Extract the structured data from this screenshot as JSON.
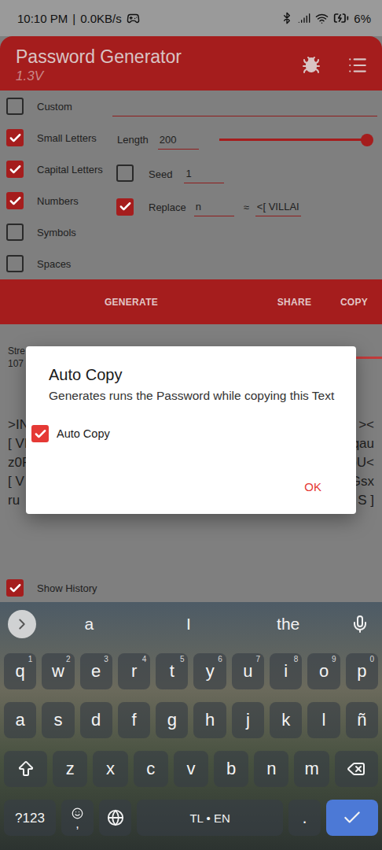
{
  "status_bar": {
    "time": "10:10 PM",
    "separator": "|",
    "network_speed": "0.0KB/s",
    "battery": "6%",
    "charging": true
  },
  "app_bar": {
    "title": "Password Generator",
    "version": "1.3V"
  },
  "options": [
    {
      "label": "Custom",
      "checked": false
    },
    {
      "label": "Small Letters",
      "checked": true
    },
    {
      "label": "Capital Letters",
      "checked": true
    },
    {
      "label": "Numbers",
      "checked": true
    },
    {
      "label": "Symbols",
      "checked": false
    },
    {
      "label": "Spaces",
      "checked": false
    }
  ],
  "length": {
    "label": "Length",
    "value": "200",
    "level": 1
  },
  "seed": {
    "label": "Seed",
    "checked": false,
    "value": "1"
  },
  "replace": {
    "label": "Replace",
    "checked": true,
    "find": "n",
    "symbol": "≈",
    "with": "<[ VILLAI"
  },
  "actions": [
    "GENERATE",
    "SHARE",
    "COPY"
  ],
  "strength": {
    "label": "Stre",
    "value": "107",
    "level": 1
  },
  "password_lines": [
    {
      "start": ">IN",
      "end": "><"
    },
    {
      "start": "[ VI",
      "end": "qau"
    },
    {
      "start": "z0F",
      "end": "pU<"
    },
    {
      "start": "[ V",
      "end": "Gsx"
    },
    {
      "start": "ru",
      "end": "S ]"
    }
  ],
  "show_history": {
    "label": "Show History",
    "checked": true
  },
  "dialog": {
    "title": "Auto Copy",
    "message": "Generates runs the Password while copying this Text",
    "checkbox": {
      "label": "Auto Copy",
      "checked": true
    },
    "buttons": [
      "OK"
    ]
  },
  "keyboard": {
    "suggestions": [
      "a",
      "I",
      "the"
    ],
    "rows": [
      [
        {
          "label": "q",
          "hint": "1"
        },
        {
          "label": "w",
          "hint": "2"
        },
        {
          "label": "e",
          "hint": "3"
        },
        {
          "label": "r",
          "hint": "4"
        },
        {
          "label": "t",
          "hint": "5"
        },
        {
          "label": "y",
          "hint": "6"
        },
        {
          "label": "u",
          "hint": "7"
        },
        {
          "label": "i",
          "hint": "8"
        },
        {
          "label": "o",
          "hint": "9"
        },
        {
          "label": "p",
          "hint": "0"
        }
      ],
      [
        {
          "label": "a",
          "hint": ""
        },
        {
          "label": "s",
          "hint": ""
        },
        {
          "label": "d",
          "hint": ""
        },
        {
          "label": "f",
          "hint": ""
        },
        {
          "label": "g",
          "hint": ""
        },
        {
          "label": "h",
          "hint": ""
        },
        {
          "label": "j",
          "hint": ""
        },
        {
          "label": "k",
          "hint": ""
        },
        {
          "label": "l",
          "hint": ""
        },
        {
          "label": "ñ",
          "hint": ""
        }
      ],
      [
        {
          "label": "z",
          "hint": ""
        },
        {
          "label": "x",
          "hint": ""
        },
        {
          "label": "c",
          "hint": ""
        },
        {
          "label": "v",
          "hint": ""
        },
        {
          "label": "b",
          "hint": ""
        },
        {
          "label": "n",
          "hint": ""
        },
        {
          "label": "m",
          "hint": ""
        }
      ]
    ],
    "symbols": "?123",
    "comma": ",",
    "space": "TL • EN",
    "period": "."
  }
}
